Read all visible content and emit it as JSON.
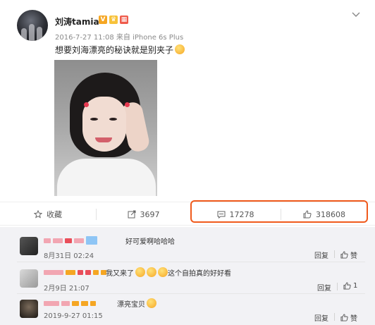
{
  "post": {
    "username": "刘涛tamia",
    "meta": "2016-7-27 11:08 来自 iPhone 6s Plus",
    "text": "想要刘海漂亮的秘诀就是别夹子",
    "chevron_icon": "chevron-down-icon"
  },
  "actions": {
    "favorite_label": "收藏",
    "repost_count": "3697",
    "comment_count": "17278",
    "like_count": "318608"
  },
  "comments": [
    {
      "text": "好可爱啊哈哈哈",
      "date": "8月31日 02:24",
      "reply": "回复",
      "like": "赞"
    },
    {
      "text": "我又来了",
      "text_suffix": "这个自拍真的好好看",
      "date": "2月9日 21:07",
      "reply": "回复",
      "like": "1"
    },
    {
      "text": "漂亮宝贝",
      "date": "2019-9-27 01:15",
      "reply": "回复",
      "like": "赞"
    }
  ],
  "colors": {
    "highlight": "#f05a1c",
    "verified": "#f5a623",
    "redacted_pink": "#f2a6b2",
    "redacted_orange": "#f5a623",
    "redacted_red": "#e94e5a",
    "redacted_blue": "#8ec5f5"
  }
}
